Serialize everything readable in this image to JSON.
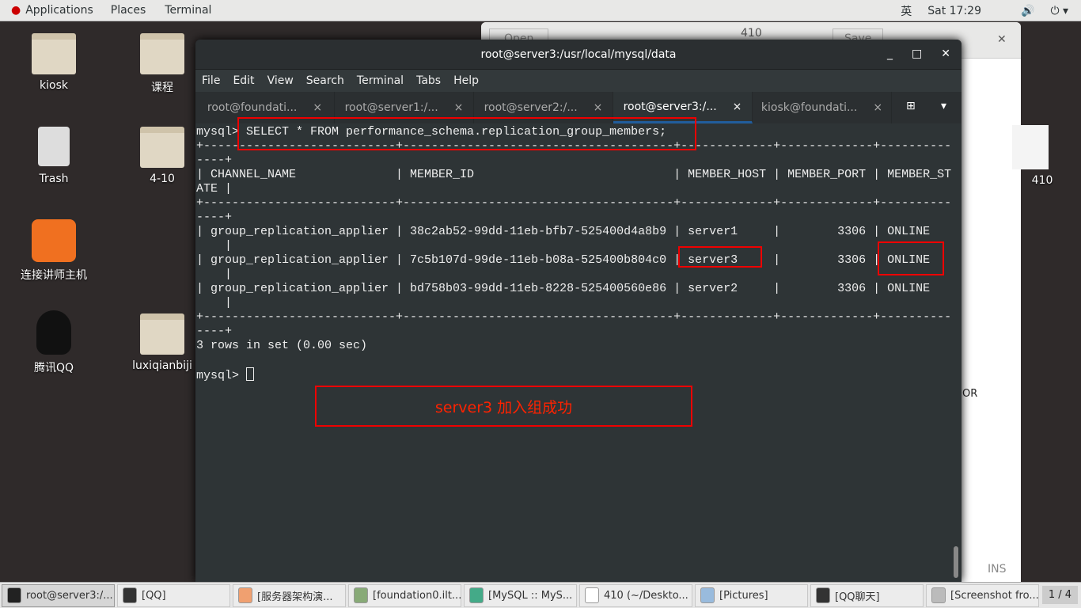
{
  "topbar": {
    "applications": "Applications",
    "places": "Places",
    "terminal": "Terminal",
    "ime": "英",
    "clock": "Sat 17:29"
  },
  "desktop": {
    "icons": [
      {
        "label": "kiosk",
        "type": "home-folder"
      },
      {
        "label": "课程",
        "type": "folder"
      },
      {
        "label": "Trash",
        "type": "trash"
      },
      {
        "label": "4-10",
        "type": "folder"
      },
      {
        "label": "连接讲师主机",
        "type": "app"
      },
      {
        "label": "腾讯QQ",
        "type": "qq"
      },
      {
        "label": "luxiqianbiji",
        "type": "folder"
      },
      {
        "label": "410",
        "type": "document"
      }
    ]
  },
  "gedit": {
    "title": "410",
    "open": "Open",
    "save": "Save",
    "partial_text": "OR",
    "status_ins": "INS"
  },
  "terminal": {
    "title": "root@server3:/usr/local/mysql/data",
    "menu": [
      "File",
      "Edit",
      "View",
      "Search",
      "Terminal",
      "Tabs",
      "Help"
    ],
    "tabs": [
      {
        "label": "root@foundati..."
      },
      {
        "label": "root@server1:/..."
      },
      {
        "label": "root@server2:/..."
      },
      {
        "label": "root@server3:/...",
        "active": true
      },
      {
        "label": "kiosk@foundati..."
      }
    ],
    "prompt": "mysql> ",
    "command": "SELECT * FROM performance_schema.replication_group_members;",
    "columns": [
      "CHANNEL_NAME",
      "MEMBER_ID",
      "MEMBER_HOST",
      "MEMBER_PORT",
      "MEMBER_STATE"
    ],
    "rows": [
      [
        "group_replication_applier",
        "38c2ab52-99dd-11eb-bfb7-525400d4a8b9",
        "server1",
        "3306",
        "ONLINE"
      ],
      [
        "group_replication_applier",
        "7c5b107d-99de-11eb-b08a-525400b804c0",
        "server3",
        "3306",
        "ONLINE"
      ],
      [
        "group_replication_applier",
        "bd758b03-99dd-11eb-8228-525400560e86",
        "server2",
        "3306",
        "ONLINE"
      ]
    ],
    "result": "3 rows in set (0.00 sec)",
    "wrap_columns": 106
  },
  "annotation": {
    "text": "server3 加入组成功",
    "color": "#ff2200"
  },
  "taskbar": {
    "items": [
      {
        "label": "root@server3:/...",
        "active": true,
        "color": "#222"
      },
      {
        "label": "[QQ]",
        "color": "#333"
      },
      {
        "label": "[服务器架构演...",
        "color": "#f0a070"
      },
      {
        "label": "[foundation0.ilt...",
        "color": "#8a7"
      },
      {
        "label": "[MySQL :: MyS...",
        "color": "#4a8"
      },
      {
        "label": "410 (~/Deskto...",
        "color": "#fff"
      },
      {
        "label": "[Pictures]",
        "color": "#9bd"
      },
      {
        "label": "[QQ聊天]",
        "color": "#333"
      },
      {
        "label": "[Screenshot fro...",
        "color": "#bbb"
      }
    ],
    "pager": "1 / 4"
  }
}
